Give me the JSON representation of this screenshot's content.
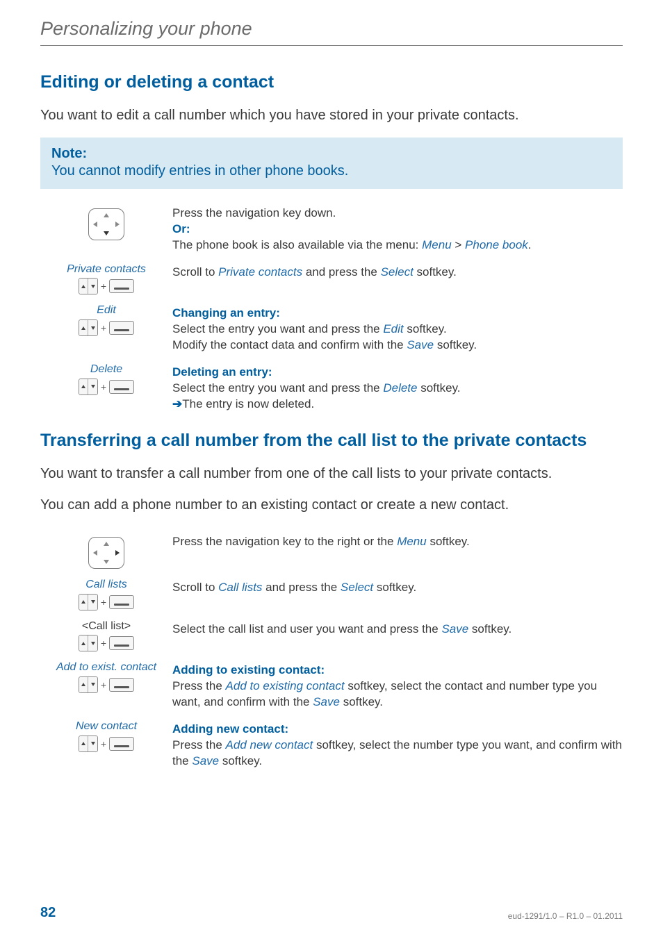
{
  "running_head": "Personalizing your phone",
  "section1": {
    "title": "Editing or deleting a contact",
    "intro": "You want to edit a call number which you have stored in your private contacts.",
    "note_title": "Note:",
    "note_text": "You cannot modify entries in other phone books.",
    "steps": [
      {
        "left_label": "",
        "icon": "nav-down",
        "lines": [
          {
            "text": "Press the navigation key down."
          },
          {
            "text": "Or:",
            "cls": "or-label"
          },
          {
            "parts": [
              {
                "t": "The phone book is also available via the menu: "
              },
              {
                "t": "Menu",
                "cls": "link"
              },
              {
                "t": " > "
              },
              {
                "t": "Phone book",
                "cls": "link"
              },
              {
                "t": "."
              }
            ]
          }
        ]
      },
      {
        "left_label": "Private contacts",
        "icon": "combo",
        "lines": [
          {
            "parts": [
              {
                "t": "Scroll to "
              },
              {
                "t": "Private contacts",
                "cls": "link"
              },
              {
                "t": " and press the "
              },
              {
                "t": "Select",
                "cls": "link"
              },
              {
                "t": " softkey."
              }
            ]
          }
        ]
      },
      {
        "left_label": "Edit",
        "icon": "combo",
        "lines": [
          {
            "text": "Changing an entry:",
            "cls": "sub-hdr"
          },
          {
            "parts": [
              {
                "t": "Select the entry you want and press the "
              },
              {
                "t": "Edit",
                "cls": "link"
              },
              {
                "t": " softkey."
              }
            ]
          },
          {
            "parts": [
              {
                "t": "Modify the contact data and confirm with the "
              },
              {
                "t": "Save",
                "cls": "link"
              },
              {
                "t": " softkey."
              }
            ]
          }
        ]
      },
      {
        "left_label": "Delete",
        "icon": "combo",
        "lines": [
          {
            "text": "Deleting an entry:",
            "cls": "sub-hdr"
          },
          {
            "parts": [
              {
                "t": "Select the entry you want and press the "
              },
              {
                "t": "Delete",
                "cls": "link"
              },
              {
                "t": " softkey."
              }
            ]
          },
          {
            "parts": [
              {
                "t": "➔",
                "cls": "arrow"
              },
              {
                "t": "The entry is now deleted."
              }
            ]
          }
        ]
      }
    ]
  },
  "section2": {
    "title": "Transferring a call number from the call list to the private contacts",
    "intro1": "You want to transfer a call number from one of the call lists to your private contacts.",
    "intro2": "You can add a phone number to an existing contact or create a new contact.",
    "steps": [
      {
        "left_label": "",
        "icon": "nav-right",
        "lines": [
          {
            "parts": [
              {
                "t": "Press the navigation key to the right or the "
              },
              {
                "t": "Menu",
                "cls": "link"
              },
              {
                "t": " softkey."
              }
            ]
          }
        ]
      },
      {
        "left_label": "Call lists",
        "icon": "combo",
        "lines": [
          {
            "parts": [
              {
                "t": "Scroll to "
              },
              {
                "t": "Call lists",
                "cls": "link"
              },
              {
                "t": " and press the "
              },
              {
                "t": "Select",
                "cls": "link"
              },
              {
                "t": " softkey."
              }
            ]
          }
        ]
      },
      {
        "left_label": "<Call list>",
        "left_label_style": "plain",
        "icon": "combo",
        "lines": [
          {
            "parts": [
              {
                "t": "Select the call list and user you want and press the "
              },
              {
                "t": "Save",
                "cls": "link"
              },
              {
                "t": " softkey."
              }
            ]
          }
        ]
      },
      {
        "left_label": "Add to exist. contact",
        "icon": "combo",
        "lines": [
          {
            "text": "Adding to existing contact:",
            "cls": "sub-hdr"
          },
          {
            "parts": [
              {
                "t": "Press the "
              },
              {
                "t": "Add to existing contact",
                "cls": "link"
              },
              {
                "t": " softkey, select the contact and number type you want, and confirm with the "
              },
              {
                "t": "Save",
                "cls": "link"
              },
              {
                "t": " softkey."
              }
            ]
          }
        ]
      },
      {
        "left_label": "New contact",
        "icon": "combo",
        "lines": [
          {
            "text": "Adding new contact:",
            "cls": "sub-hdr"
          },
          {
            "parts": [
              {
                "t": "Press the "
              },
              {
                "t": "Add new contact",
                "cls": "link"
              },
              {
                "t": " softkey, select the number type you want, and confirm with the "
              },
              {
                "t": "Save",
                "cls": "link"
              },
              {
                "t": " softkey."
              }
            ]
          }
        ]
      }
    ]
  },
  "footer": {
    "page": "82",
    "docid": "eud-1291/1.0 – R1.0 – 01.2011"
  }
}
